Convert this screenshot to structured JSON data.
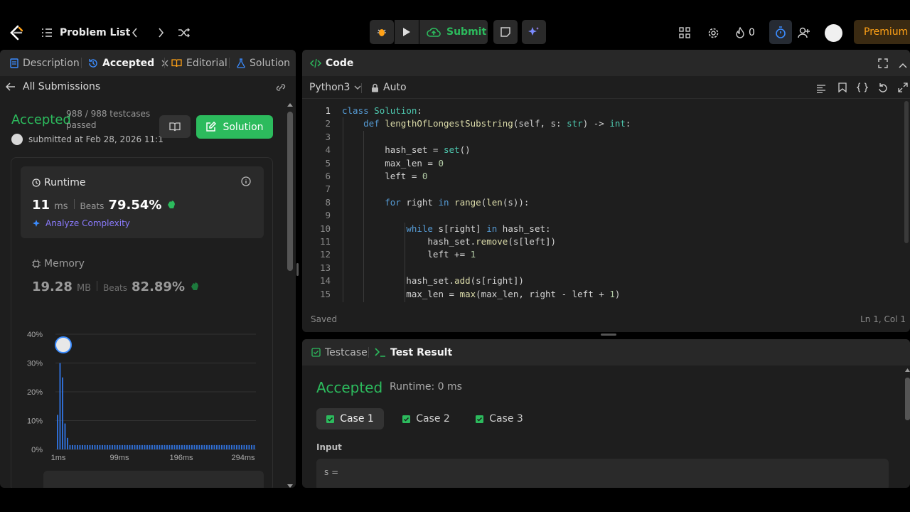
{
  "topbar": {
    "problem_list": "Problem List",
    "submit": "Submit",
    "streak": "0",
    "premium": "Premium"
  },
  "left": {
    "tabs": [
      "Description",
      "Accepted",
      "Editorial",
      "Solution"
    ],
    "all_submissions": "All Submissions",
    "status": "Accepted",
    "testcases": "988 / 988 testcases",
    "passed": "passed",
    "submitted": "submitted at Feb 28, 2026 11:1",
    "solution_btn": "Solution",
    "runtime": {
      "label": "Runtime",
      "value": "11",
      "unit": "ms",
      "beats_label": "Beats",
      "beats": "79.54%",
      "analyze": "Analyze Complexity"
    },
    "memory": {
      "label": "Memory",
      "value": "19.28",
      "unit": "MB",
      "beats_label": "Beats",
      "beats": "82.89%"
    }
  },
  "chart_data": {
    "type": "bar",
    "y_ticks": [
      "40%",
      "30%",
      "20%",
      "10%",
      "0%"
    ],
    "x_ticks": [
      "1ms",
      "99ms",
      "196ms",
      "294ms"
    ],
    "ylim": [
      0,
      40
    ],
    "values": [
      12,
      30,
      25,
      9,
      4,
      1.5,
      1.5,
      1.5,
      1.5,
      1.5,
      1.5,
      1.5,
      1.5,
      1.5,
      1.5,
      1.5,
      1.5,
      1.5,
      1.5,
      1.5,
      1.5,
      1.5,
      1.5,
      1.5,
      1.5,
      1.5,
      1.5,
      1.5,
      1.5,
      1.5,
      1.5,
      1.5,
      1.5,
      1.5,
      1.5,
      1.5,
      1.5,
      1.5,
      1.5,
      1.5,
      1.5,
      1.5,
      1.5,
      1.5,
      1.5,
      1.5,
      1.5,
      1.5,
      1.5,
      1.5,
      1.5,
      1.5,
      1.5,
      1.5,
      1.5,
      1.5,
      1.5,
      1.5,
      1.5,
      1.5,
      1.5,
      1.5,
      1.5,
      1.5,
      1.5,
      1.5,
      1.5,
      1.5,
      1.5,
      1.5,
      1.5,
      1.5,
      1.5,
      1.5,
      1.5,
      1.5,
      1.5,
      1.5,
      1.5,
      1.5
    ]
  },
  "code": {
    "title": "Code",
    "language": "Python3",
    "mode": "Auto",
    "saved": "Saved",
    "cursor": "Ln 1, Col 1",
    "line_numbers": [
      "1",
      "2",
      "3",
      "4",
      "5",
      "6",
      "7",
      "8",
      "9",
      "10",
      "11",
      "12",
      "13",
      "14",
      "15"
    ]
  },
  "result": {
    "tab_testcase": "Testcase",
    "tab_result": "Test Result",
    "status": "Accepted",
    "runtime": "Runtime: 0 ms",
    "cases": [
      "Case 1",
      "Case 2",
      "Case 3"
    ],
    "input_label": "Input",
    "input_value": "s ="
  }
}
